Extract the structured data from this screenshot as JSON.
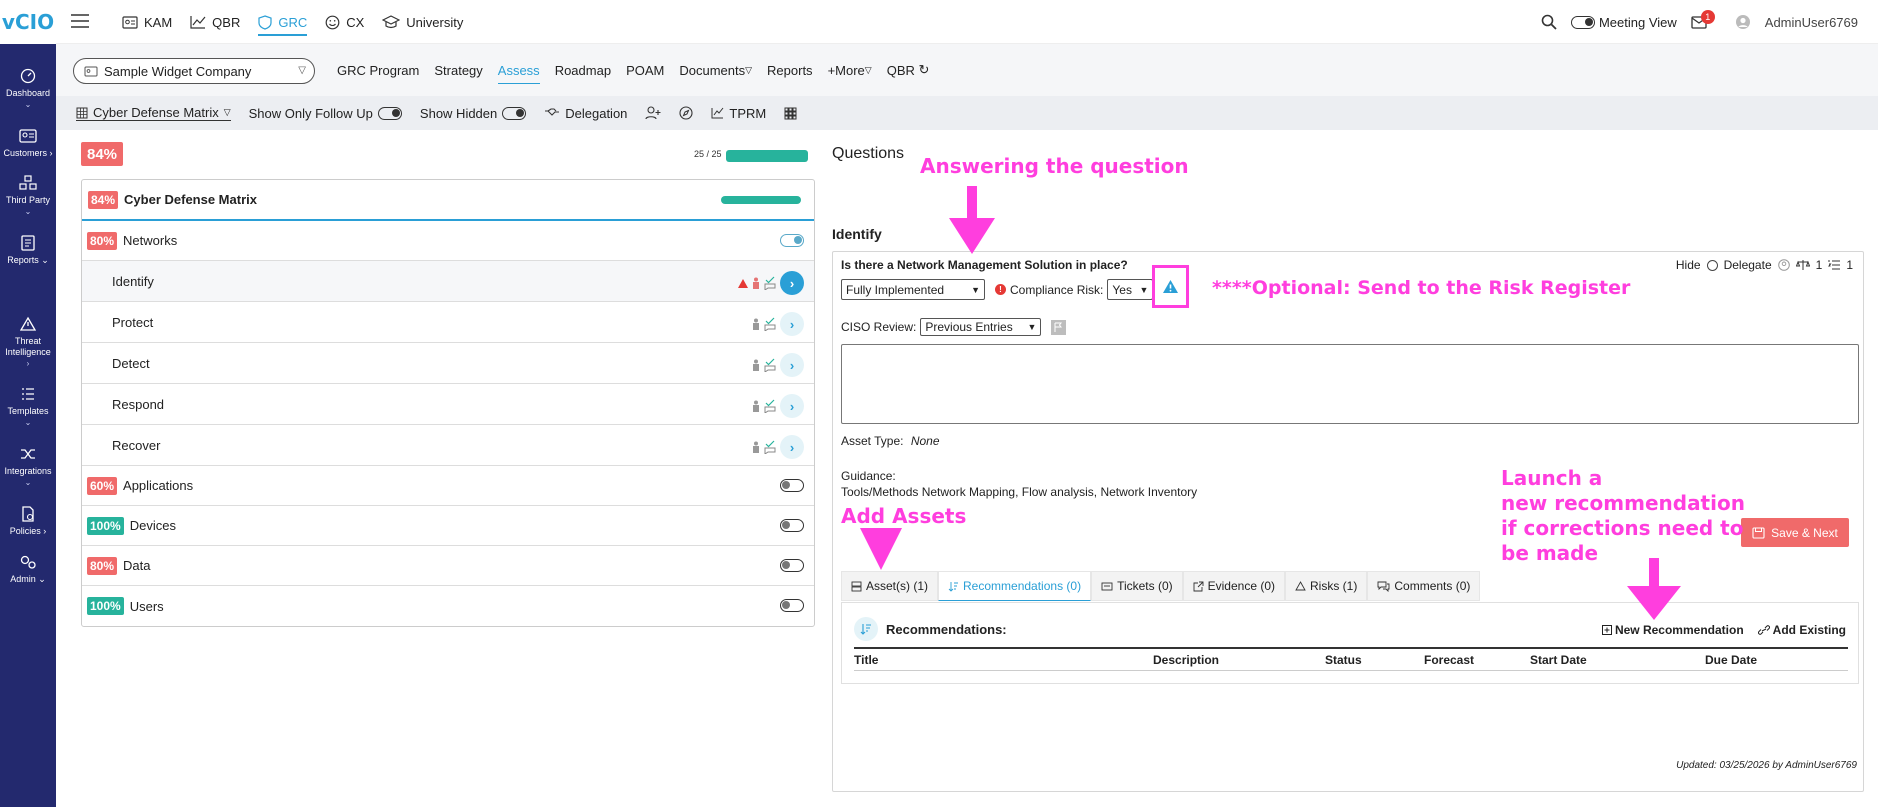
{
  "logo_text": "vCIO",
  "rail": [
    {
      "label": "Dashboard",
      "icon": "dashboard-icon"
    },
    {
      "label": "Customers",
      "icon": "customers-icon"
    },
    {
      "label": "Third Party",
      "icon": "third-party-icon"
    },
    {
      "label": "Reports",
      "icon": "reports-icon"
    },
    {
      "label": "Threat Intelligence",
      "icon": "threat-icon"
    },
    {
      "label": "Templates",
      "icon": "templates-icon"
    },
    {
      "label": "Integrations",
      "icon": "integrations-icon"
    },
    {
      "label": "Policies",
      "icon": "policies-icon"
    },
    {
      "label": "Admin",
      "icon": "admin-icon"
    }
  ],
  "topnav": [
    {
      "label": "KAM"
    },
    {
      "label": "QBR"
    },
    {
      "label": "GRC"
    },
    {
      "label": "CX"
    },
    {
      "label": "University"
    }
  ],
  "topright": {
    "meeting_view": "Meeting View",
    "notifications": "1",
    "user": "AdminUser6769"
  },
  "company": "Sample Widget Company",
  "prognav": [
    "GRC Program",
    "Strategy",
    "Assess",
    "Roadmap",
    "POAM",
    "Documents",
    "Reports",
    "+More",
    "QBR"
  ],
  "toolbar": {
    "matrix": "Cyber Defense Matrix",
    "follow_up": "Show Only Follow Up",
    "hidden": "Show Hidden",
    "delegation": "Delegation",
    "tprm": "TPRM"
  },
  "overall_pct": "84%",
  "progress_text": "25 / 25",
  "matrix": {
    "title": "Cyber Defense Matrix",
    "pct": "84%",
    "rows": [
      {
        "pct": "80%",
        "label": "Networks",
        "color": "#f06a6a"
      },
      {
        "label": "Identify"
      },
      {
        "label": "Protect"
      },
      {
        "label": "Detect"
      },
      {
        "label": "Respond"
      },
      {
        "label": "Recover"
      },
      {
        "pct": "60%",
        "label": "Applications",
        "color": "#f06a6a"
      },
      {
        "pct": "100%",
        "label": "Devices",
        "color": "#27b39c"
      },
      {
        "pct": "80%",
        "label": "Data",
        "color": "#f06a6a"
      },
      {
        "pct": "100%",
        "label": "Users",
        "color": "#27b39c"
      }
    ]
  },
  "questions": {
    "title": "Questions",
    "section": "Identify",
    "question": "Is there a Network Management Solution in place?",
    "hide": "Hide",
    "delegate": "Delegate",
    "count_a": "1",
    "count_b": "1",
    "answer": "Fully Implemented",
    "compliance_label": "Compliance Risk:",
    "compliance_value": "Yes",
    "ciso_label": "CISO Review:",
    "ciso_value": "Previous Entries",
    "asset_type_label": "Asset Type:",
    "asset_type_value": "None",
    "guidance_label": "Guidance:",
    "guidance_text": "Tools/Methods Network Mapping, Flow analysis, Network Inventory",
    "save_next": "Save & Next",
    "tabs": [
      "Asset(s) (1)",
      "Recommendations (0)",
      "Tickets (0)",
      "Evidence (0)",
      "Risks (1)",
      "Comments (0)"
    ],
    "rec_title": "Recommendations:",
    "new_rec": "New Recommendation",
    "add_existing": "Add Existing",
    "columns": [
      "Title",
      "Description",
      "Status",
      "Forecast",
      "Start Date",
      "Due Date"
    ],
    "updated": "Updated: 03/25/2026 by AdminUser6769"
  },
  "annotations": {
    "answering": "Answering the question",
    "optional": "****Optional: Send to the Risk Register",
    "add_assets": "Add Assets",
    "launch_1": "Launch a",
    "launch_2": "new recommendation",
    "launch_3": "if corrections need to",
    "launch_4": "be made"
  },
  "colors": {
    "accent": "#2a9fd6",
    "red": "#f06a6a",
    "green": "#27b39c",
    "rail": "#23296e",
    "annotation": "#ff3ede"
  }
}
